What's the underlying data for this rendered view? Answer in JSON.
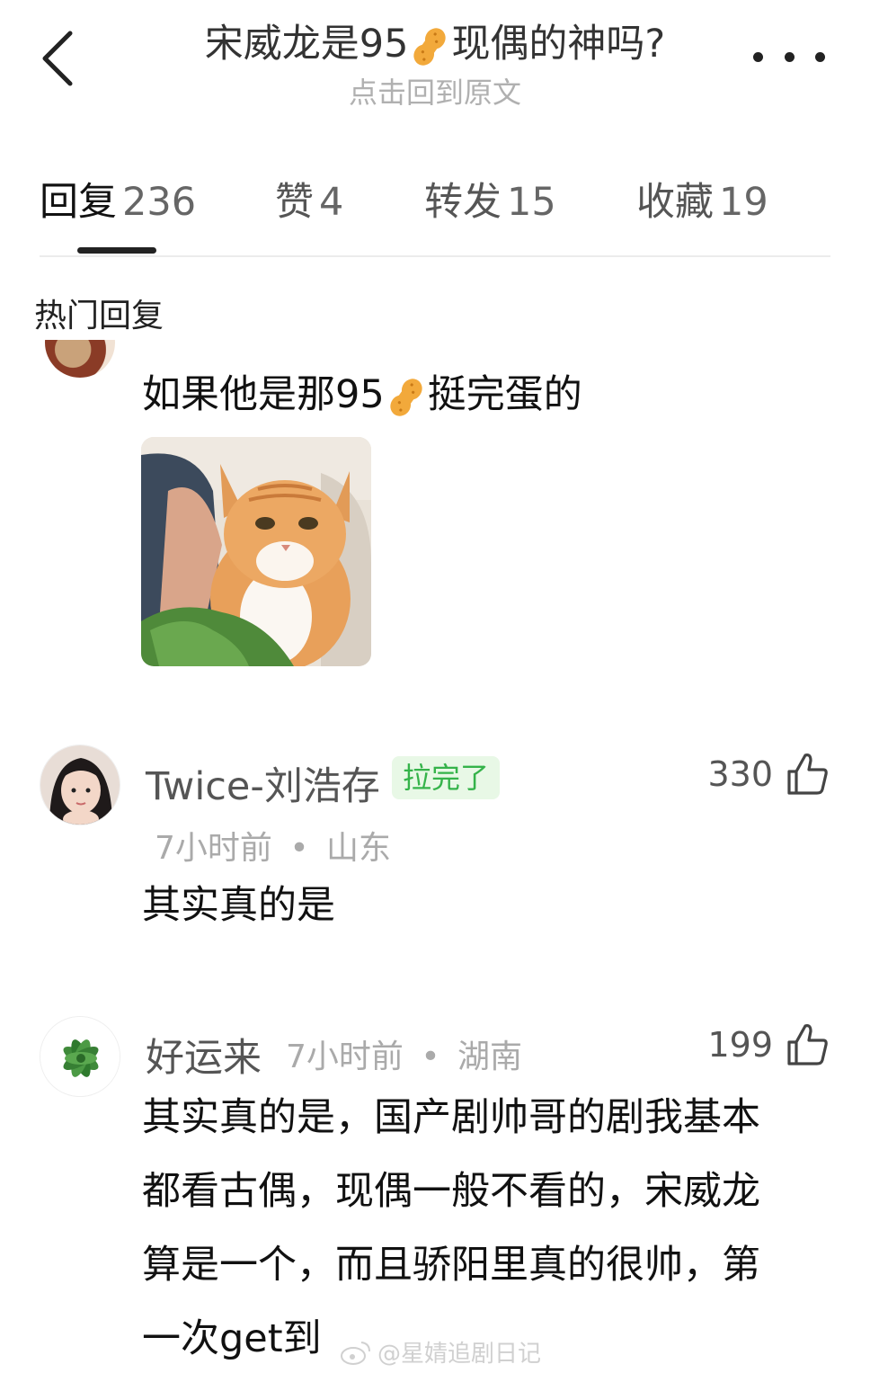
{
  "header": {
    "title_part1": "宋威龙是95",
    "title_part2": "现偶的神吗?",
    "subtitle": "点击回到原文"
  },
  "tabs": [
    {
      "label": "回复",
      "count": "236",
      "active": true
    },
    {
      "label": "赞",
      "count": "4"
    },
    {
      "label": "转发",
      "count": "15"
    },
    {
      "label": "收藏",
      "count": "19"
    }
  ],
  "section_title": "热门回复",
  "comments": [
    {
      "text_part1": "如果他是那95",
      "text_part2": "挺完蛋的",
      "image": "orange-cat-photo"
    },
    {
      "username": "Twice-刘浩存",
      "badge": "拉完了",
      "time": "7小时前",
      "location": "山东",
      "likes": "330",
      "text": "其实真的是"
    },
    {
      "username": "好运来",
      "time": "7小时前",
      "location": "湖南",
      "likes": "199",
      "lines": [
        "其实真的是，国产剧帅哥的剧我基本",
        "都看古偶，现偶一般不看的，宋威龙",
        "算是一个，而且骄阳里真的很帅，第",
        "一次get到"
      ]
    }
  ],
  "meta_separator": "•",
  "watermark": "@星婧追剧日记",
  "colors": {
    "badge_bg": "#e8f8e6",
    "badge_text": "#35b34a",
    "peanut": "#f2a93b"
  },
  "icons": [
    "back-arrow-icon",
    "more-dots-icon",
    "peanut-icon",
    "thumbs-up-icon",
    "weibo-icon"
  ]
}
